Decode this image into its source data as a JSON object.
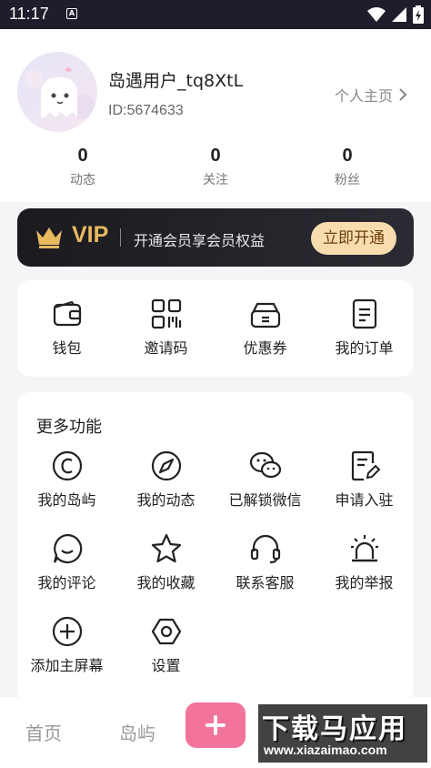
{
  "status_bar": {
    "time": "11:17",
    "notification_icon": "A"
  },
  "profile": {
    "username": "岛遇用户_tq8XtL",
    "user_id": "ID:5674633",
    "homepage_link": "个人主页",
    "stats": [
      {
        "value": "0",
        "label": "动态"
      },
      {
        "value": "0",
        "label": "关注"
      },
      {
        "value": "0",
        "label": "粉丝"
      }
    ]
  },
  "vip": {
    "badge": "VIP",
    "description": "开通会员享会员权益",
    "button_label": "立即开通",
    "colors": {
      "gold": "#e9b960",
      "button_bg": "#f8dcae"
    }
  },
  "quick_actions": [
    {
      "label": "钱包",
      "icon": "wallet-icon"
    },
    {
      "label": "邀请码",
      "icon": "qr-code-icon"
    },
    {
      "label": "优惠券",
      "icon": "coupon-icon"
    },
    {
      "label": "我的订单",
      "icon": "order-icon"
    }
  ],
  "more_features": {
    "title": "更多功能",
    "items": [
      {
        "label": "我的岛屿",
        "icon": "island-icon"
      },
      {
        "label": "我的动态",
        "icon": "compass-icon"
      },
      {
        "label": "已解锁微信",
        "icon": "wechat-icon"
      },
      {
        "label": "申请入驻",
        "icon": "apply-icon"
      },
      {
        "label": "我的评论",
        "icon": "comment-icon"
      },
      {
        "label": "我的收藏",
        "icon": "star-icon"
      },
      {
        "label": "联系客服",
        "icon": "headset-icon"
      },
      {
        "label": "我的举报",
        "icon": "alarm-icon"
      },
      {
        "label": "添加主屏幕",
        "icon": "add-circle-icon"
      },
      {
        "label": "设置",
        "icon": "settings-icon"
      }
    ]
  },
  "bottom_nav": {
    "items": [
      "首页",
      "岛屿"
    ],
    "fab_color": "#f3749a"
  },
  "watermark": {
    "main": "下载马应用",
    "url": "www.xiazaimao.com"
  }
}
